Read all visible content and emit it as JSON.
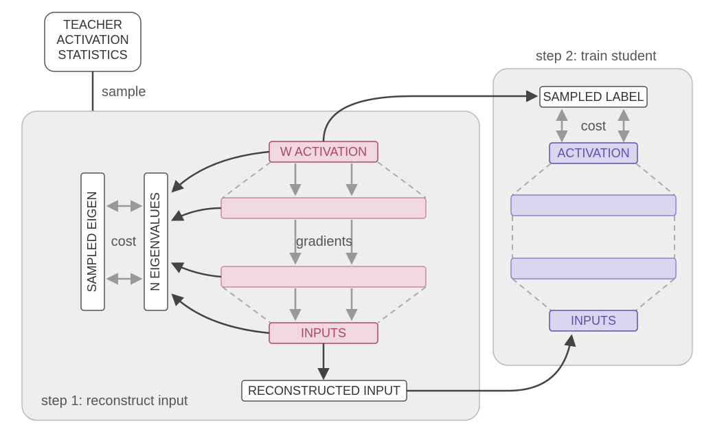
{
  "teacher_stats": {
    "line1": "TEACHER",
    "line2": "ACTIVATION",
    "line3": "STATISTICS"
  },
  "sample_label": "sample",
  "step1": {
    "title": "step 1: reconstruct input",
    "sampled_eigen": "SAMPLED EIGEN",
    "n_eigen": "N EIGENVALUES",
    "cost": "cost",
    "w_activation": "W ACTIVATION",
    "gradients": "gradients",
    "inputs": "INPUTS",
    "reconstructed": "RECONSTRUCTED INPUT"
  },
  "step2": {
    "title": "step 2: train student",
    "sampled_label": "SAMPLED LABEL",
    "cost": "cost",
    "activation": "ACTIVATION",
    "inputs": "INPUTS"
  }
}
